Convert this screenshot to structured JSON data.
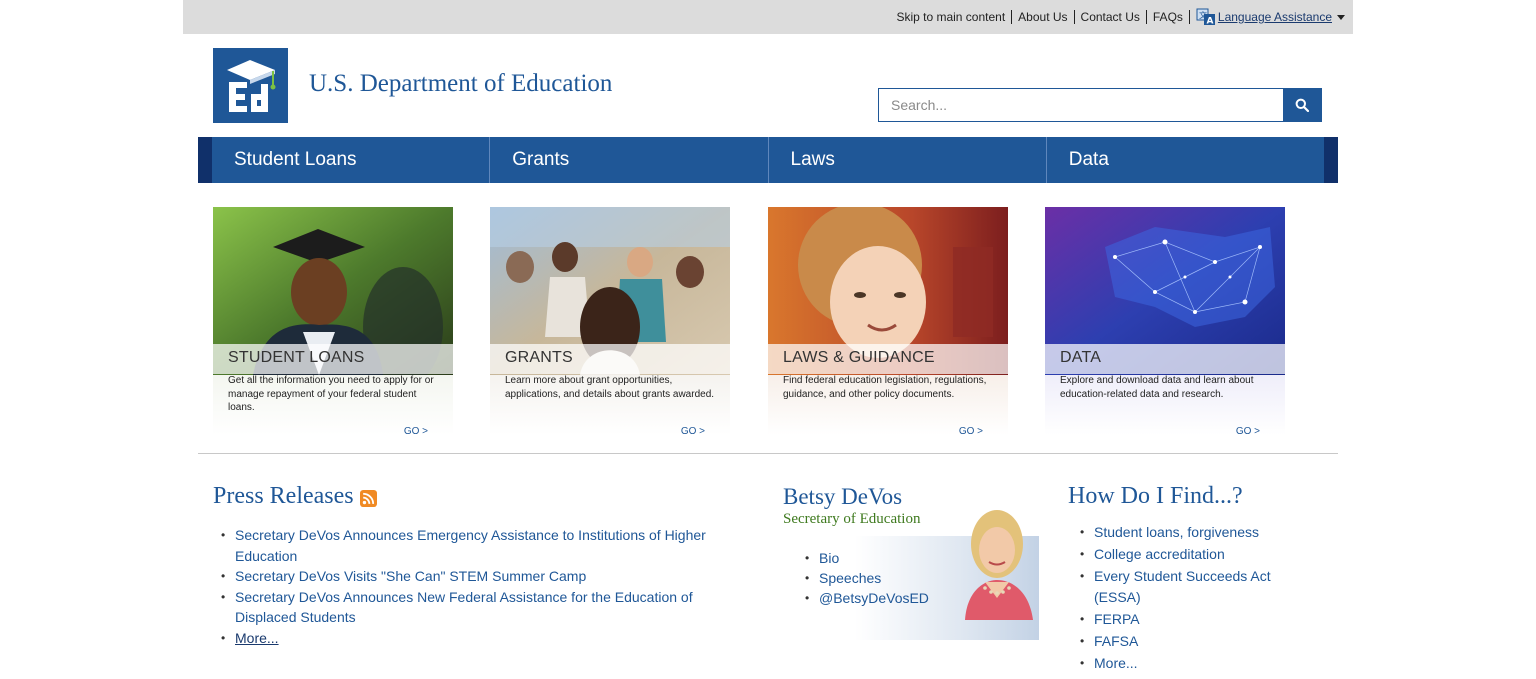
{
  "utility_nav": {
    "links": [
      "Skip to main content",
      "About Us",
      "Contact Us",
      "FAQs"
    ],
    "language": "Language Assistance"
  },
  "header": {
    "title": "U.S. Department of Education",
    "search_placeholder": "Search..."
  },
  "main_nav": {
    "tabs": [
      "Student Loans",
      "Grants",
      "Laws",
      "Data"
    ]
  },
  "cards": [
    {
      "title": "STUDENT LOANS",
      "description": "Get all the information you need to apply for or manage repayment of your federal student loans.",
      "link": "GO >"
    },
    {
      "title": "GRANTS",
      "description": "Learn more about grant opportunities, applications, and details about grants awarded.",
      "link": "GO >"
    },
    {
      "title": "LAWS & GUIDANCE",
      "description": "Find federal education legislation, regulations, guidance, and other policy documents.",
      "link": "GO >"
    },
    {
      "title": "DATA",
      "description": "Explore and download data and learn about education-related data and research.",
      "link": "GO >"
    }
  ],
  "press_releases": {
    "title": "Press Releases",
    "items": [
      "Secretary DeVos Announces Emergency Assistance to Institutions of Higher Education",
      "Secretary DeVos Visits \"She Can\" STEM Summer Camp",
      "Secretary DeVos Announces New Federal Assistance for the Education of Displaced Students",
      "More..."
    ]
  },
  "secretary": {
    "name": "Betsy DeVos",
    "role": "Secretary of Education",
    "links": [
      "Bio",
      "Speeches",
      "@BetsyDeVosED"
    ]
  },
  "how_do_i_find": {
    "title": "How Do I Find...?",
    "items": [
      "Student loans, forgiveness",
      "College accreditation",
      "Every Student Succeeds Act (ESSA)",
      "FERPA",
      "FAFSA",
      "More..."
    ]
  },
  "colors": {
    "brand_blue": "#1f5797",
    "nav_edge": "#10306a",
    "secretary_green": "#3f7a1f",
    "util_bar": "#dcdcdc"
  },
  "icons": [
    "language-icon",
    "search-icon",
    "rss-icon",
    "ed-logo"
  ]
}
